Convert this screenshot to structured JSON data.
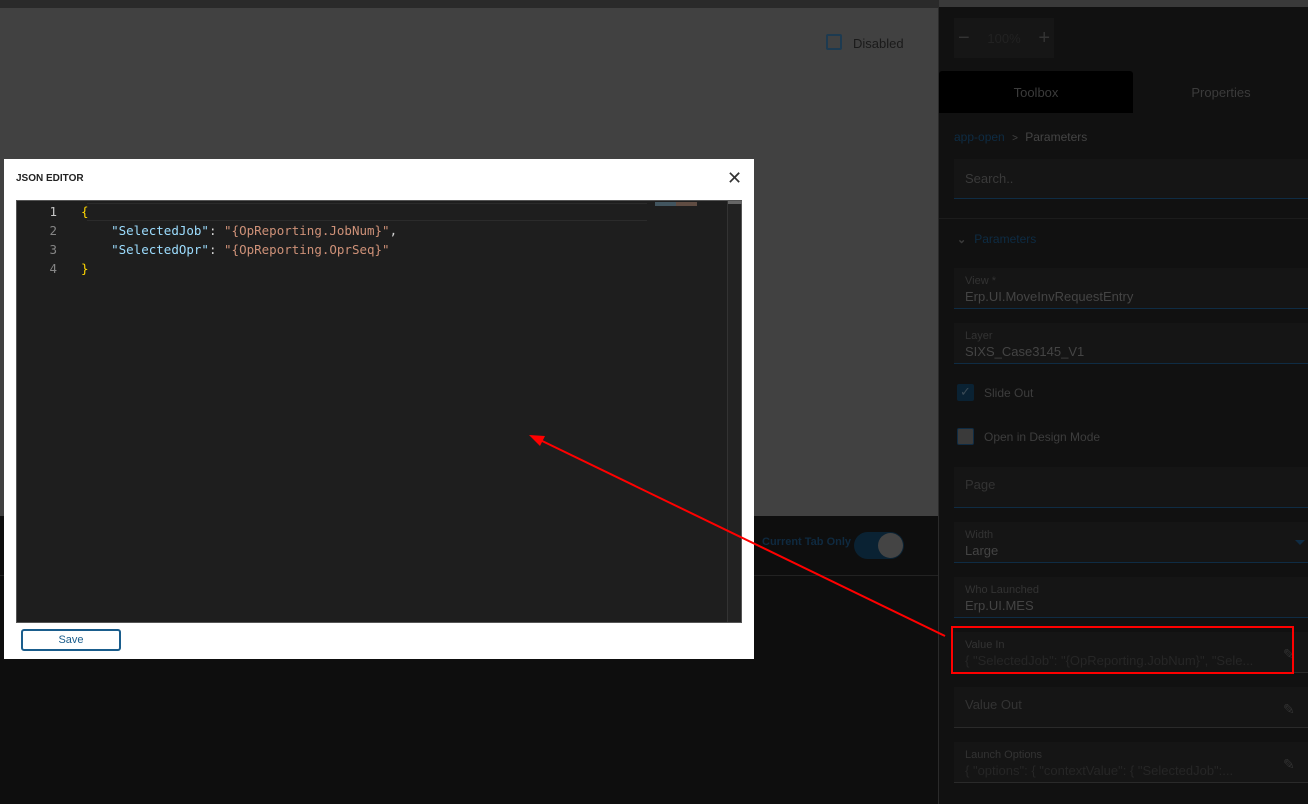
{
  "canvas": {
    "disabled_label": "Disabled",
    "current_tab_only_label": "Current Tab Only"
  },
  "panel": {
    "zoom": {
      "minus": "−",
      "value": "100%",
      "plus": "+"
    },
    "tabs": [
      "Toolbox",
      "Properties"
    ],
    "breadcrumb": {
      "link": "app-open",
      "sep": ">",
      "current": "Parameters"
    },
    "search_placeholder": "Search..",
    "section": "Parameters",
    "fields": {
      "view": {
        "label": "View *",
        "value": "Erp.UI.MoveInvRequestEntry"
      },
      "layer": {
        "label": "Layer",
        "value": "SIXS_Case3145_V1"
      },
      "slide_out": "Slide Out",
      "design_mode": "Open in Design Mode",
      "page": {
        "label": "Page"
      },
      "width": {
        "label": "Width",
        "value": "Large"
      },
      "who_launched": {
        "label": "Who Launched",
        "value": "Erp.UI.MES"
      },
      "value_in": {
        "label": "Value In",
        "value": "{ \"SelectedJob\": \"{OpReporting.JobNum}\", \"Sele..."
      },
      "value_out": {
        "label": "Value Out"
      },
      "launch_options": {
        "label": "Launch Options",
        "value": "{ \"options\": {   \"contextValue\": {     \"SelectedJob\":..."
      }
    }
  },
  "modal": {
    "title": "JSON EDITOR",
    "close": "✕",
    "line_numbers": [
      "1",
      "2",
      "3",
      "4"
    ],
    "lines": {
      "l1": "{",
      "l2_key": "\"SelectedJob\"",
      "l2_val": "\"{OpReporting.JobNum}\"",
      "l3_key": "\"SelectedOpr\"",
      "l3_val": "\"{OpReporting.OprSeq}\"",
      "l4": "}"
    },
    "save": "Save"
  },
  "colors": {
    "accent": "#1a5d8c",
    "annotation": "#ff0000"
  }
}
